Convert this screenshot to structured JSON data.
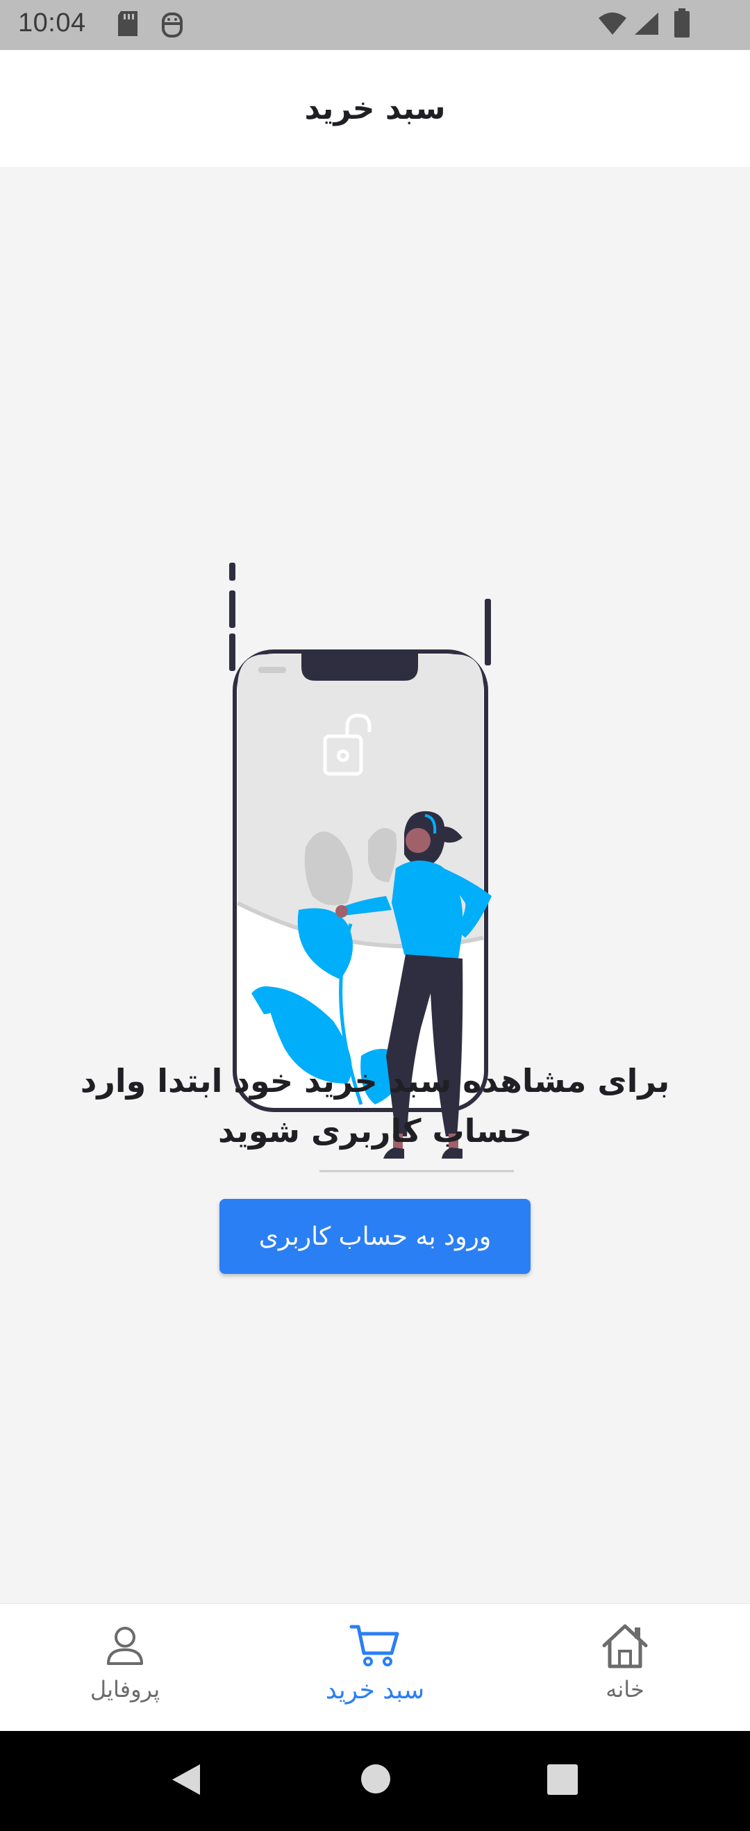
{
  "status_bar": {
    "time": "10:04",
    "icons": [
      "sd-card-icon",
      "android-debug-icon",
      "wifi-icon",
      "signal-icon",
      "battery-icon"
    ]
  },
  "app_bar": {
    "title": "سبد خرید"
  },
  "main": {
    "illustration": "locked-phone-woman-illustration",
    "message_line1": "برای مشاهده سبد خرید خود ابتدا وارد",
    "message_line2": "حساب کاربری شوید",
    "login_button_label": "ورود به حساب کاربری"
  },
  "bottom_nav": {
    "items": [
      {
        "label": "پروفایل",
        "icon": "user-icon",
        "active": false
      },
      {
        "label": "سبد خرید",
        "icon": "cart-icon",
        "active": true
      },
      {
        "label": "خانه",
        "icon": "home-icon",
        "active": false
      }
    ]
  },
  "colors": {
    "accent": "#2b7ff4",
    "illustration_blue": "#00aefa",
    "dark": "#2f2e41",
    "background": "#f4f4f5"
  },
  "system_nav": [
    "back-icon",
    "home-circle-icon",
    "recents-icon"
  ]
}
